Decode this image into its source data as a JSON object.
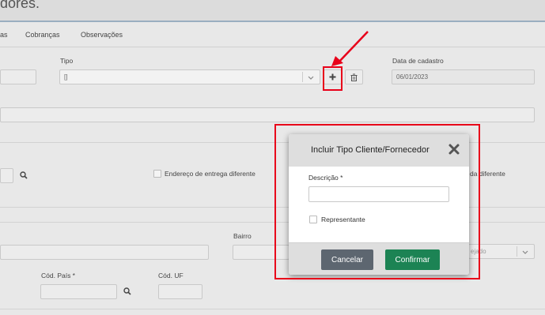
{
  "header": {
    "title": "dores."
  },
  "tabs": [
    {
      "label": "as"
    },
    {
      "label": "Cobranças"
    },
    {
      "label": "Observações"
    }
  ],
  "form": {
    "tipo_label": "Tipo",
    "tipo_value": "[]",
    "data_cadastro_label": "Data de cadastro",
    "data_cadastro_value": "06/01/2023",
    "endereco_entrega_label": "Endereço de entrega diferente",
    "endereco_cobranca_partial": "da diferente",
    "bairro_label": "Bairro",
    "cod_pais_label": "Cód. País *",
    "cod_uf_label": "Cód. UF",
    "select_partial": "ejado"
  },
  "modal": {
    "title": "Incluir Tipo Cliente/Fornecedor",
    "descricao_label": "Descrição *",
    "descricao_value": "",
    "representante_label": "Representante",
    "cancel_label": "Cancelar",
    "confirm_label": "Confirmar"
  },
  "colors": {
    "accent_red": "#e8001a",
    "cancel_btn": "#5d6670",
    "confirm_btn": "#1c8354"
  },
  "icons": [
    "plus-icon",
    "trash-icon",
    "search-icon",
    "close-icon",
    "chevron-down-icon",
    "arrow-annotation"
  ]
}
